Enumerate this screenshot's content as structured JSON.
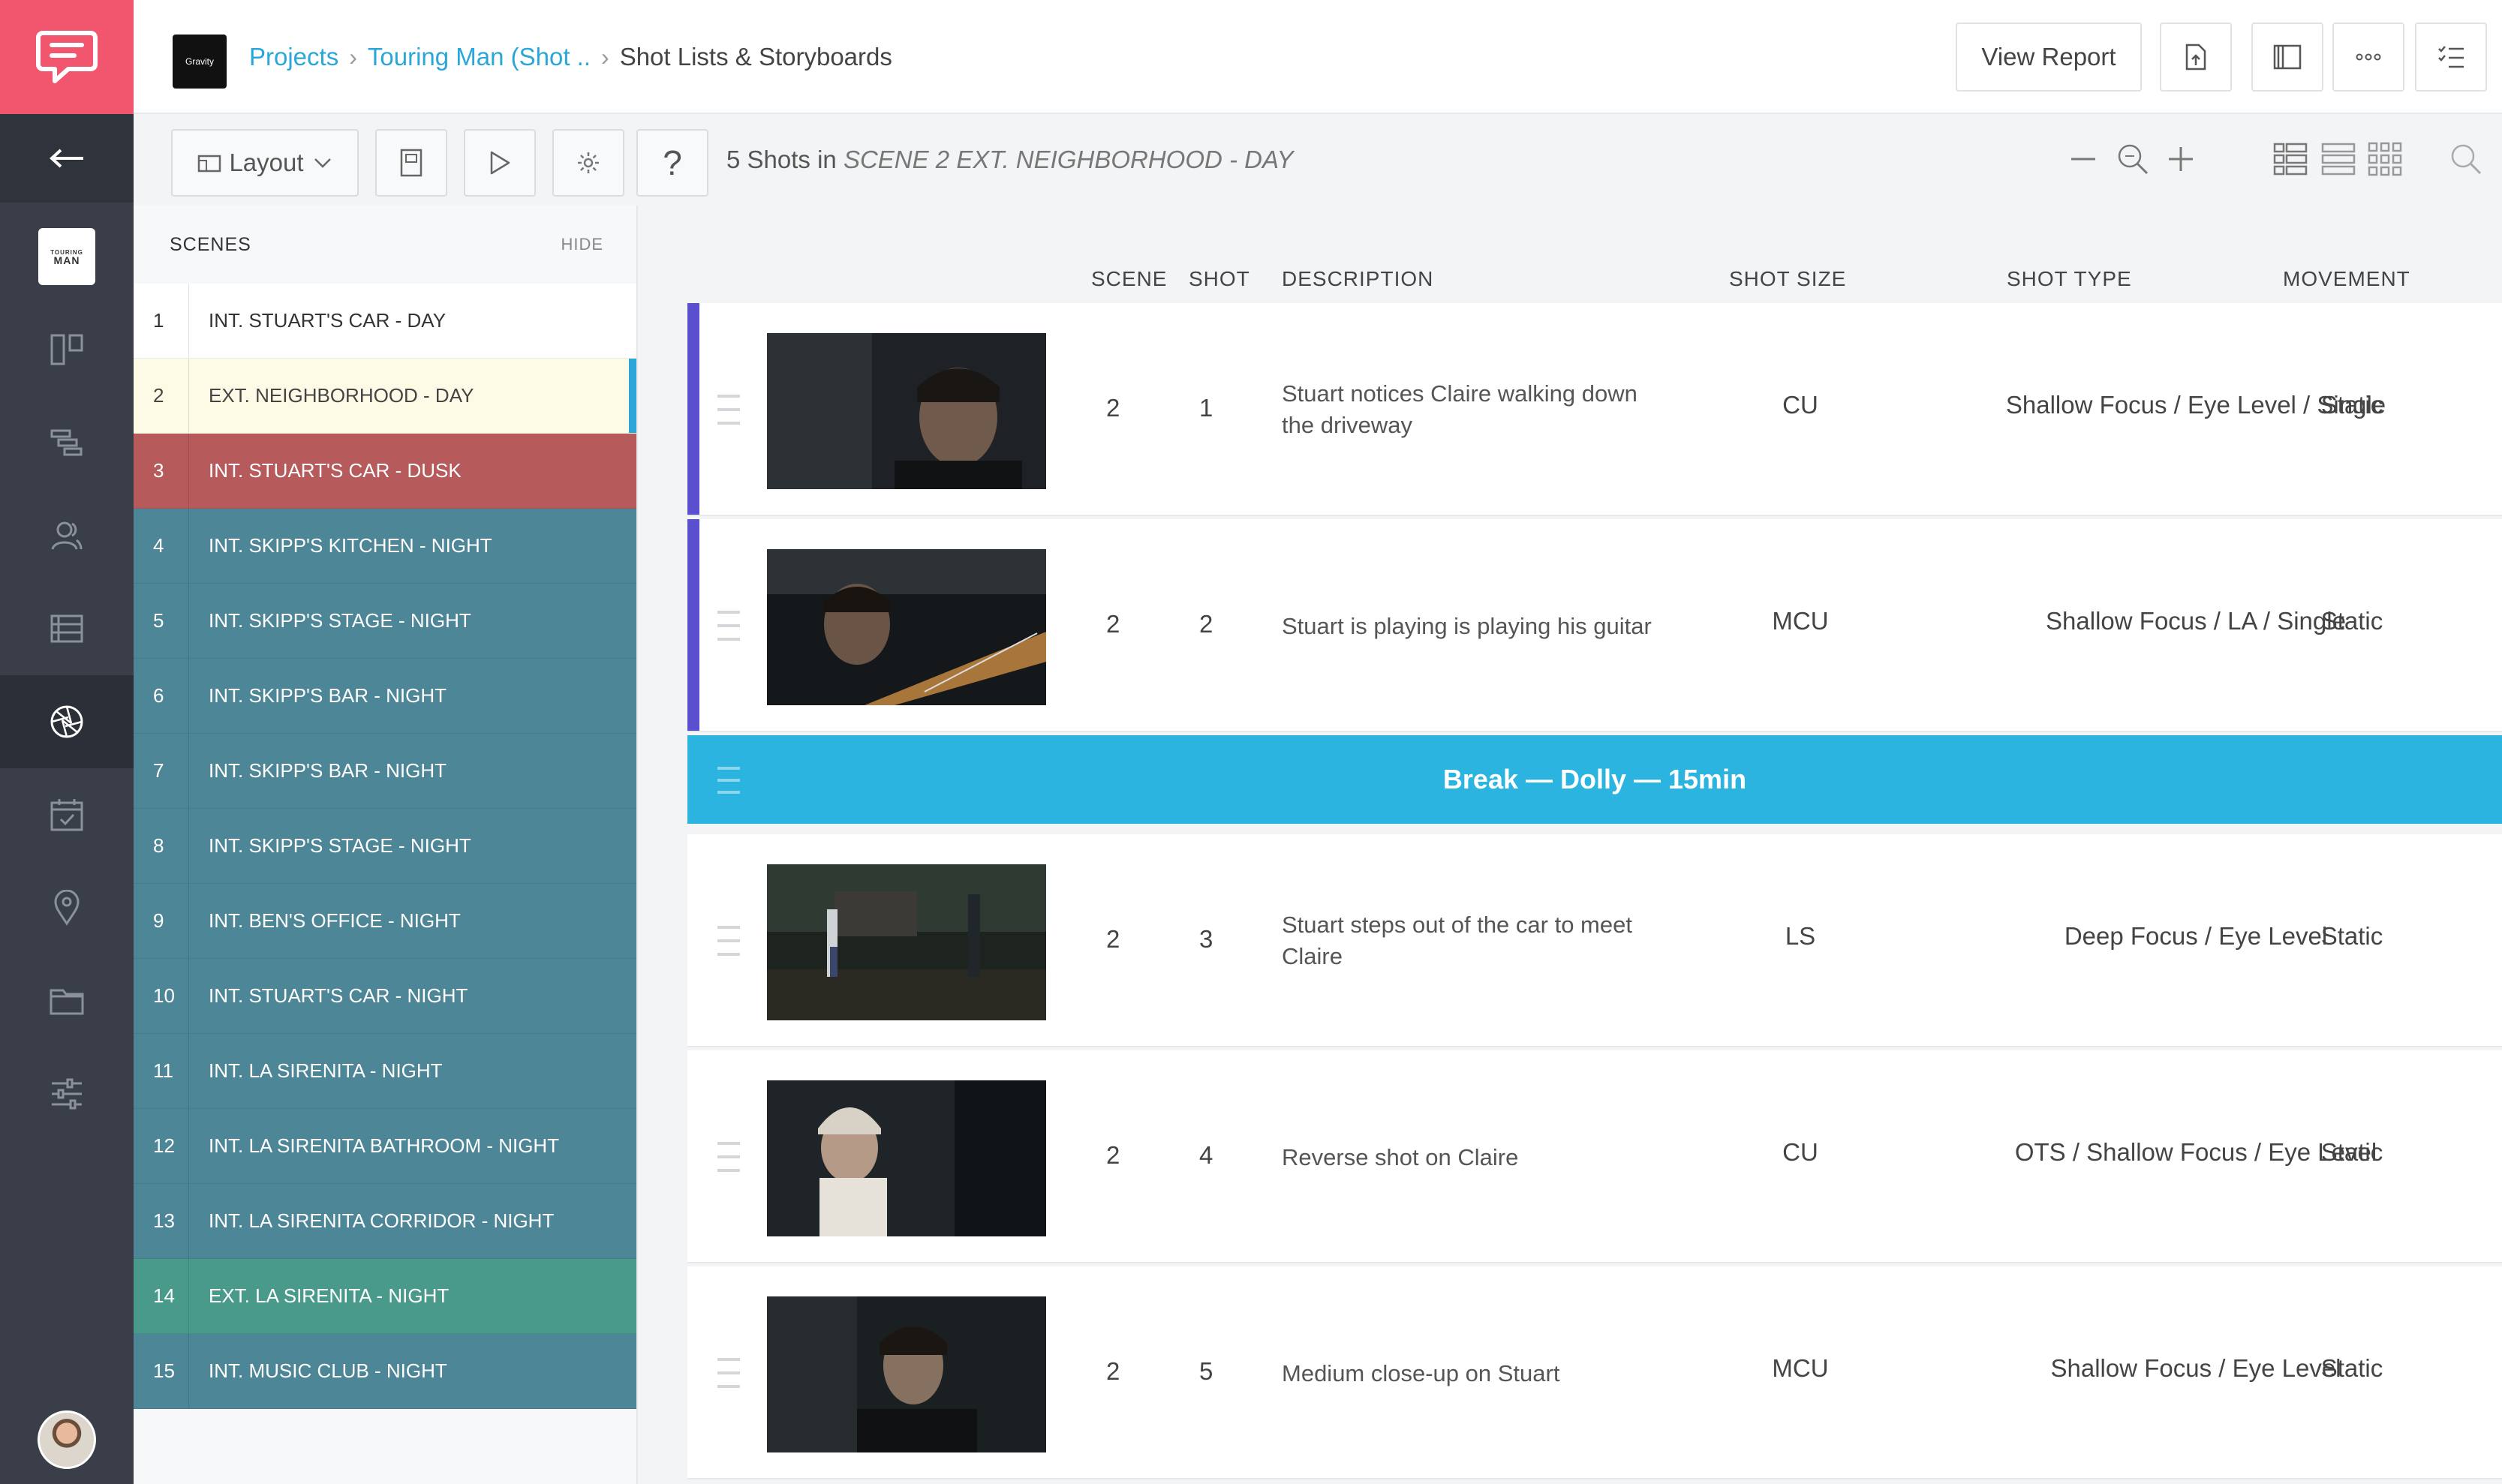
{
  "header": {
    "org_logo_text": "Gravity",
    "breadcrumb": [
      "Projects",
      "Touring Man (Shot ..",
      "Shot Lists & Storyboards"
    ],
    "view_report": "View Report"
  },
  "sidebar": {
    "project_thumb_text": [
      "TOURING",
      "MAN"
    ],
    "nav_icons": [
      "back-arrow-icon",
      "boards-icon",
      "schedule-icon",
      "contacts-icon",
      "shotlist-icon",
      "aperture-icon",
      "calendar-icon",
      "location-icon",
      "folder-icon",
      "settings-sliders-icon"
    ]
  },
  "toolbar": {
    "layout_label": "Layout",
    "help_label": "?",
    "shots_count_text": "5 Shots in",
    "scene_context": "SCENE 2 EXT. NEIGHBORHOOD - DAY"
  },
  "scenes_panel": {
    "title": "SCENES",
    "hide_label": "HIDE",
    "items": [
      {
        "num": "1",
        "name": "INT. STUART'S CAR - DAY",
        "color": "#ffffff"
      },
      {
        "num": "2",
        "name": "EXT. NEIGHBORHOOD - DAY",
        "color": "#fdfbe6"
      },
      {
        "num": "3",
        "name": "INT. STUART'S CAR - DUSK",
        "color": "#b65a5c"
      },
      {
        "num": "4",
        "name": "INT. SKIPP'S KITCHEN - NIGHT",
        "color": "#4d8697"
      },
      {
        "num": "5",
        "name": "INT. SKIPP'S STAGE - NIGHT",
        "color": "#4d8697"
      },
      {
        "num": "6",
        "name": "INT. SKIPP'S BAR - NIGHT",
        "color": "#4d8697"
      },
      {
        "num": "7",
        "name": "INT. SKIPP'S BAR - NIGHT",
        "color": "#4d8697"
      },
      {
        "num": "8",
        "name": "INT. SKIPP'S STAGE - NIGHT",
        "color": "#4d8697"
      },
      {
        "num": "9",
        "name": "INT. BEN'S OFFICE - NIGHT",
        "color": "#4d8697"
      },
      {
        "num": "10",
        "name": "INT. STUART'S CAR - NIGHT",
        "color": "#4d8697"
      },
      {
        "num": "11",
        "name": "INT. LA SIRENITA - NIGHT",
        "color": "#4d8697"
      },
      {
        "num": "12",
        "name": "INT. LA SIRENITA BATHROOM - NIGHT",
        "color": "#4d8697"
      },
      {
        "num": "13",
        "name": "INT. LA SIRENITA CORRIDOR - NIGHT",
        "color": "#4d8697"
      },
      {
        "num": "14",
        "name": "EXT. LA SIRENITA - NIGHT",
        "color": "#4a9a8c"
      },
      {
        "num": "15",
        "name": "INT. MUSIC CLUB - NIGHT",
        "color": "#4d8697"
      }
    ]
  },
  "table": {
    "columns": [
      "SCENE",
      "SHOT",
      "DESCRIPTION",
      "SHOT SIZE",
      "SHOT TYPE",
      "MOVEMENT"
    ],
    "rows": [
      {
        "scene": "2",
        "shot": "1",
        "description": "Stuart notices Claire walking down the driveway",
        "size": "CU",
        "type": "Shallow Focus / Eye Level / Single",
        "movement": "Static",
        "accent": "#5a4fcf"
      },
      {
        "scene": "2",
        "shot": "2",
        "description": "Stuart is playing is playing his guitar",
        "size": "MCU",
        "type": "Shallow Focus / LA / Single",
        "movement": "Static",
        "accent": "#5a4fcf"
      },
      {
        "scene": "2",
        "shot": "3",
        "description": "Stuart steps out of the car to meet Claire",
        "size": "LS",
        "type": "Deep Focus / Eye Level",
        "movement": "Static",
        "accent": "#ffffff"
      },
      {
        "scene": "2",
        "shot": "4",
        "description": "Reverse shot on Claire",
        "size": "CU",
        "type": "OTS / Shallow Focus / Eye Level",
        "movement": "Static",
        "accent": "#ffffff"
      },
      {
        "scene": "2",
        "shot": "5",
        "description": "Medium close-up on Stuart",
        "size": "MCU",
        "type": "Shallow Focus / Eye Level",
        "movement": "Static",
        "accent": "#ffffff"
      }
    ],
    "break_label": "Break — Dolly — 15min",
    "break_color": "#2ab4df"
  },
  "colors": {
    "brand": "#f2566f",
    "link": "#2aa6d8",
    "rail": "#3a3e48"
  }
}
